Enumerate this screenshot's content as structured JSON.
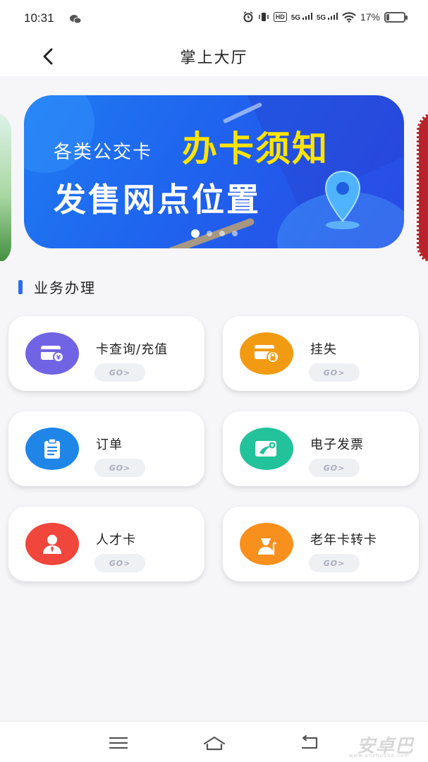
{
  "status_bar": {
    "time": "10:31",
    "wechat_icon": "wechat-icon",
    "hd": "HD",
    "net1": "5G",
    "net2": "5G",
    "battery": "17%",
    "battery_level": 0.17
  },
  "header": {
    "back_icon": "chevron-left-icon",
    "title": "掌上大厅"
  },
  "banner": {
    "line1": "各类公交卡",
    "highlight": "办卡须知",
    "line2": "发售网点位置",
    "dot_count": 4,
    "active_dot": 0,
    "colors": {
      "bg_start": "#1f7bf2",
      "bg_end": "#2a49e6",
      "highlight": "#ffe400"
    }
  },
  "section": {
    "title": "业务办理",
    "accent": "#2f6bf2"
  },
  "services": [
    {
      "label": "卡查询/充值",
      "go": "GO>",
      "icon": "card-yen-icon",
      "color": "#7064e4"
    },
    {
      "label": "挂失",
      "go": "GO>",
      "icon": "card-lock-icon",
      "color": "#f29b12"
    },
    {
      "label": "订单",
      "go": "GO>",
      "icon": "clipboard-icon",
      "color": "#1f86e8"
    },
    {
      "label": "电子发票",
      "go": "GO>",
      "icon": "invoice-icon",
      "color": "#22c29a"
    },
    {
      "label": "人才卡",
      "go": "GO>",
      "icon": "person-icon",
      "color": "#f0463c"
    },
    {
      "label": "老年卡转卡",
      "go": "GO>",
      "icon": "elder-icon",
      "color": "#f7901c"
    }
  ],
  "nav_bar": {
    "menu_icon": "menu-icon",
    "home_icon": "home-icon",
    "back_icon": "back-icon",
    "watermark": "安卓巴",
    "watermark_sub": "www.anzhuoba.com"
  }
}
